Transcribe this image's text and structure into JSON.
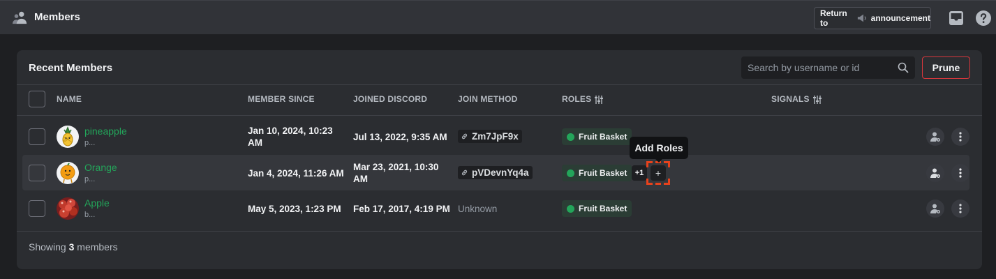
{
  "header": {
    "title": "Members",
    "return_prefix": "Return to",
    "return_channel": "announcement",
    "icons": [
      "members-icon",
      "megaphone-icon",
      "inbox-icon",
      "help-icon"
    ]
  },
  "panel": {
    "title": "Recent Members",
    "search_placeholder": "Search by username or id",
    "prune_label": "Prune"
  },
  "table": {
    "columns": {
      "name": "NAME",
      "member_since": "MEMBER SINCE",
      "joined_discord": "JOINED DISCORD",
      "join_method": "JOIN METHOD",
      "roles": "ROLES",
      "signals": "SIGNALS"
    },
    "rows": [
      {
        "username": "pineapple",
        "subname": "p...",
        "member_since": "Jan 10, 2024, 10:23 AM",
        "joined_discord": "Jul 13, 2022, 9:35 AM",
        "join_method": "Zm7JpF9x",
        "role": "Fruit Basket",
        "extra_roles": ""
      },
      {
        "username": "Orange",
        "subname": "p...",
        "member_since": "Jan 4, 2024, 11:26 AM",
        "joined_discord": "Mar 23, 2021, 10:30 AM",
        "join_method": "pVDevnYq4a",
        "role": "Fruit Basket",
        "extra_roles": "+1"
      },
      {
        "username": "Apple",
        "subname": "b...",
        "member_since": "May 5, 2023, 1:23 PM",
        "joined_discord": "Feb 17, 2017, 4:19 PM",
        "join_method": "Unknown",
        "role": "Fruit Basket",
        "extra_roles": ""
      }
    ]
  },
  "tooltip": {
    "text": "Add Roles"
  },
  "add_role_symbol": "+",
  "footer": {
    "prefix": "Showing",
    "count": "3",
    "suffix": "members"
  },
  "colors": {
    "accent_green": "#23a55a",
    "danger_red": "#da373c",
    "background": "#1e1f22",
    "panel": "#2b2d31"
  }
}
